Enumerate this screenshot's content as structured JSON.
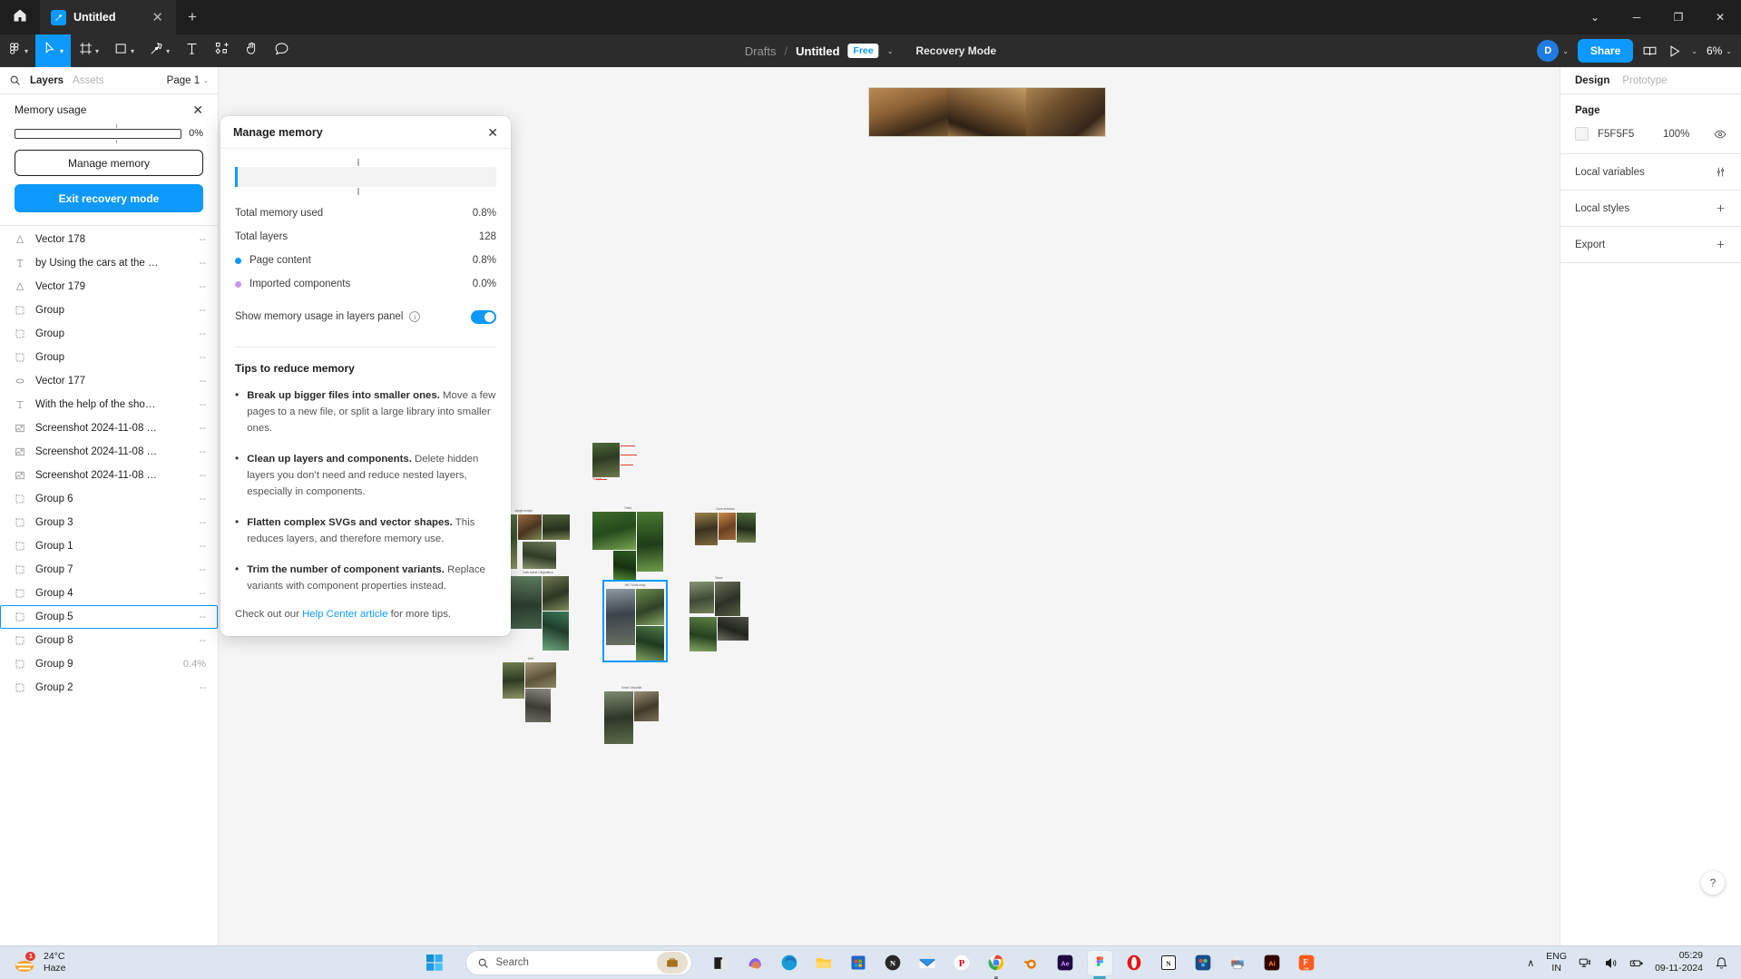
{
  "titlebar": {
    "home_label": "home-icon",
    "tab": {
      "label": "Untitled",
      "close": "✕"
    },
    "new_tab": "+",
    "window_controls": {
      "chevron": "⌄",
      "minimize": "─",
      "maximize": "❐",
      "close": "✕"
    }
  },
  "toolbar": {
    "tools": [
      {
        "name": "figma-menu",
        "icon": "figma",
        "caret": true,
        "active": false
      },
      {
        "name": "move-tool",
        "icon": "cursor",
        "caret": true,
        "active": true
      },
      {
        "name": "frame-tool",
        "icon": "frame",
        "caret": true,
        "active": false
      },
      {
        "name": "shape-tool",
        "icon": "square",
        "caret": true,
        "active": false
      },
      {
        "name": "pen-tool",
        "icon": "pen",
        "caret": true,
        "active": false
      },
      {
        "name": "text-tool",
        "icon": "text",
        "caret": false,
        "active": false
      },
      {
        "name": "resources-tool",
        "icon": "components",
        "caret": false,
        "active": false
      },
      {
        "name": "hand-tool",
        "icon": "hand",
        "caret": false,
        "active": false
      },
      {
        "name": "comment-tool",
        "icon": "comment",
        "caret": false,
        "active": false
      }
    ],
    "breadcrumb_root": "Drafts",
    "breadcrumb_sep": "/",
    "file_title": "Untitled",
    "plan_badge": "Free",
    "file_caret": "⌄",
    "mode_label": "Recovery Mode",
    "avatar_initial": "D",
    "avatar_caret": "⌄",
    "share_label": "Share",
    "present_caret": "⌄",
    "zoom_level": "6%",
    "zoom_caret": "⌄"
  },
  "left_panel": {
    "search_icon": "search-icon",
    "tabs": [
      {
        "label": "Layers",
        "active": true
      },
      {
        "label": "Assets",
        "active": false
      }
    ],
    "page_selector": "Page 1",
    "page_caret": "⌄",
    "memory_usage": {
      "title": "Memory usage",
      "close": "✕",
      "percent": "0%",
      "manage_label": "Manage memory",
      "exit_label": "Exit recovery mode"
    },
    "layers": [
      {
        "name": "Vector 178",
        "icon": "vector-icon",
        "value": "--",
        "selected": false
      },
      {
        "name": "by Using the cars at the …",
        "icon": "text-icon",
        "value": "--",
        "selected": false
      },
      {
        "name": "Vector 179",
        "icon": "vector-icon",
        "value": "--",
        "selected": false
      },
      {
        "name": "Group",
        "icon": "group-icon",
        "value": "--",
        "selected": false
      },
      {
        "name": "Group",
        "icon": "group-icon",
        "value": "--",
        "selected": false
      },
      {
        "name": "Group",
        "icon": "group-icon",
        "value": "--",
        "selected": false
      },
      {
        "name": "Vector 177",
        "icon": "ellipse-icon",
        "value": "--",
        "selected": false
      },
      {
        "name": "With the help of the sho…",
        "icon": "text-icon",
        "value": "--",
        "selected": false
      },
      {
        "name": "Screenshot 2024-11-08 …",
        "icon": "image-icon",
        "value": "--",
        "selected": false
      },
      {
        "name": "Screenshot 2024-11-08 …",
        "icon": "image-icon",
        "value": "--",
        "selected": false
      },
      {
        "name": "Screenshot 2024-11-08 …",
        "icon": "image-icon",
        "value": "--",
        "selected": false
      },
      {
        "name": "Group 6",
        "icon": "group-icon",
        "value": "--",
        "selected": false
      },
      {
        "name": "Group 3",
        "icon": "group-icon",
        "value": "--",
        "selected": false
      },
      {
        "name": "Group 1",
        "icon": "group-icon",
        "value": "--",
        "selected": false
      },
      {
        "name": "Group 7",
        "icon": "group-icon",
        "value": "--",
        "selected": false
      },
      {
        "name": "Group 4",
        "icon": "group-icon",
        "value": "--",
        "selected": false
      },
      {
        "name": "Group 5",
        "icon": "group-icon",
        "value": "--",
        "selected": true
      },
      {
        "name": "Group 8",
        "icon": "group-icon",
        "value": "--",
        "selected": false
      },
      {
        "name": "Group 9",
        "icon": "group-icon",
        "value": "0.4%",
        "selected": false
      },
      {
        "name": "Group 2",
        "icon": "group-icon",
        "value": "--",
        "selected": false
      }
    ]
  },
  "dialog": {
    "title": "Manage memory",
    "close": "✕",
    "stats": [
      {
        "label": "Total memory used",
        "value": "0.8%",
        "dot": null
      },
      {
        "label": "Total layers",
        "value": "128",
        "dot": null
      },
      {
        "label": "Page content",
        "value": "0.8%",
        "dot": "#0d99ff"
      },
      {
        "label": "Imported components",
        "value": "0.0%",
        "dot": "#c697f0"
      }
    ],
    "toggle_label": "Show memory usage in layers panel",
    "toggle_on": true,
    "tips_title": "Tips to reduce memory",
    "tips": [
      {
        "bold": "Break up bigger files into smaller ones.",
        "rest": " Move a few pages to a new file, or split a large library into smaller ones."
      },
      {
        "bold": "Clean up layers and components.",
        "rest": " Delete hidden layers you don’t need and reduce nested layers, especially in components."
      },
      {
        "bold": "Flatten complex SVGs and vector shapes.",
        "rest": " This reduces layers, and therefore memory use."
      },
      {
        "bold": "Trim the number of component variants.",
        "rest": " Replace variants with component properties instead."
      }
    ],
    "footer_prefix": "Check out our ",
    "footer_link": "Help Center article",
    "footer_suffix": " for more tips."
  },
  "right_panel": {
    "tabs": [
      {
        "label": "Design",
        "active": true
      },
      {
        "label": "Prototype",
        "active": false
      }
    ],
    "page_section_title": "Page",
    "fill_hex": "F5F5F5",
    "fill_opacity": "100%",
    "visibility_icon": "eye-icon",
    "rows": [
      {
        "label": "Local variables",
        "action_icon": "sliders-icon"
      },
      {
        "label": "Local styles",
        "action_icon": "plus-icon"
      },
      {
        "label": "Export",
        "action_icon": "plus-icon"
      }
    ],
    "help_fab": "?"
  },
  "canvas": {
    "boards": [
      {
        "label": "",
        "name": "banner-board"
      },
      {
        "label": "Temple",
        "name": "temple-annotated-board"
      },
      {
        "label": "Jungle temple",
        "name": "jungle-temple-board"
      },
      {
        "label": "Trees",
        "name": "trees-board"
      },
      {
        "label": "Cave entrance",
        "name": "cave-entrance-board"
      },
      {
        "label": "Dark forest / Vegetation",
        "name": "dark-forest-board"
      },
      {
        "label": "Hill / Tomb entry",
        "name": "hill-tomb-board"
      },
      {
        "label": "Stone",
        "name": "stone-board"
      },
      {
        "label": "Well",
        "name": "well-board"
      },
      {
        "label": "Tomb / Monolith",
        "name": "tomb-monolith-board"
      }
    ]
  },
  "taskbar": {
    "weather": {
      "temp": "24°C",
      "condition": "Haze",
      "badge": "1"
    },
    "start_icon": "windows-start-icon",
    "search_placeholder": "Search",
    "apps": [
      {
        "name": "file-explorer-dark-icon",
        "glyph": "◰",
        "bg": "#2b2b2b",
        "fg": "#ffffff",
        "running": false
      },
      {
        "name": "copilot-icon",
        "glyph": "",
        "bg": "#f0f0f0",
        "fg": "#9a58d6",
        "running": false
      },
      {
        "name": "edge-icon",
        "glyph": "",
        "bg": "#ffffff",
        "fg": "#1a9bd7",
        "running": false
      },
      {
        "name": "file-explorer-icon",
        "glyph": "",
        "bg": "#ffc83d",
        "fg": "#ffffff",
        "running": false
      },
      {
        "name": "microsoft-store-icon",
        "glyph": "",
        "bg": "#1e5fbd",
        "fg": "#ffffff",
        "running": false
      },
      {
        "name": "notion-dark-icon",
        "glyph": "N",
        "bg": "#262626",
        "fg": "#ffffff",
        "running": false
      },
      {
        "name": "mail-icon",
        "glyph": "",
        "bg": "#2d7dd2",
        "fg": "#ffffff",
        "running": false
      },
      {
        "name": "pinterest-icon",
        "glyph": "P",
        "bg": "#ffffff",
        "fg": "#e60023",
        "running": false
      },
      {
        "name": "chrome-icon",
        "glyph": "",
        "bg": "#ffffff",
        "fg": "#4285f4",
        "running": true
      },
      {
        "name": "blender-icon",
        "glyph": "",
        "bg": "#f3f3f3",
        "fg": "#ea7600",
        "running": false
      },
      {
        "name": "after-effects-icon",
        "glyph": "Ae",
        "bg": "#1f0740",
        "fg": "#cf96fd",
        "running": false
      },
      {
        "name": "figma-icon",
        "glyph": "",
        "bg": "#ffffff",
        "fg": "#0acf83",
        "running": true
      },
      {
        "name": "opera-icon",
        "glyph": "O",
        "bg": "#ffffff",
        "fg": "#e4171d",
        "running": false
      },
      {
        "name": "notion-icon",
        "glyph": "N",
        "bg": "#ffffff",
        "fg": "#1e1e1e",
        "running": false
      },
      {
        "name": "davinci-resolve-icon",
        "glyph": "",
        "bg": "#1b4b8a",
        "fg": "#ffffff",
        "running": false
      },
      {
        "name": "printer-icon",
        "glyph": "",
        "bg": "#e8eef5",
        "fg": "#5a6b7d",
        "running": false
      },
      {
        "name": "illustrator-icon",
        "glyph": "Ai",
        "bg": "#330000",
        "fg": "#ff9a00",
        "running": false
      },
      {
        "name": "filmora-icon",
        "glyph": "F",
        "bg": "#ff5a1f",
        "fg": "#ffffff",
        "running": false
      }
    ],
    "tray": {
      "chevron": "∧",
      "language_line1": "ENG",
      "language_line2": "IN",
      "network_icon": "network-icon",
      "volume_icon": "volume-icon",
      "battery_icon": "battery-icon",
      "time": "05:29",
      "date": "09-11-2024",
      "notification_icon": "bell-icon"
    }
  }
}
